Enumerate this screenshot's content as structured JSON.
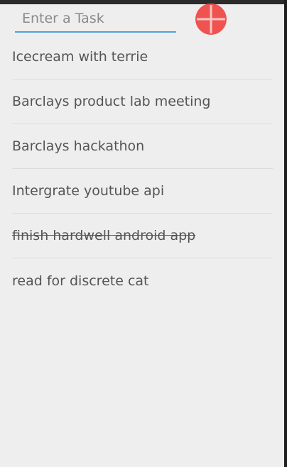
{
  "input": {
    "placeholder": "Enter a Task",
    "value": ""
  },
  "add_button": {
    "icon": "plus-icon",
    "color": "#ef5350"
  },
  "tasks": [
    {
      "label": "Icecream with terrie",
      "completed": false
    },
    {
      "label": "Barclays product lab meeting",
      "completed": false
    },
    {
      "label": "Barclays hackathon",
      "completed": false
    },
    {
      "label": "Intergrate youtube api",
      "completed": false
    },
    {
      "label": "finish hardwell android app",
      "completed": true
    },
    {
      "label": "read for discrete cat",
      "completed": false
    }
  ]
}
